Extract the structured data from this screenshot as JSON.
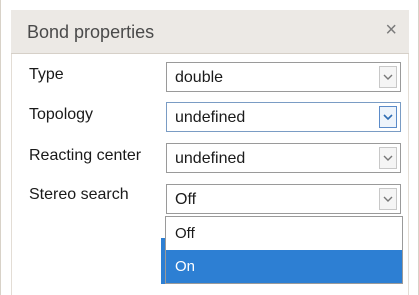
{
  "dialog": {
    "title": "Bond properties",
    "close_glyph": "×"
  },
  "fields": [
    {
      "label": "Type",
      "value": "double"
    },
    {
      "label": "Topology",
      "value": "undefined"
    },
    {
      "label": "Reacting center",
      "value": "undefined"
    },
    {
      "label": "Stereo search",
      "value": "Off"
    }
  ],
  "stereo_dropdown": {
    "options": [
      "Off",
      "On"
    ],
    "highlighted": "On"
  },
  "icons": {
    "close": "close-icon",
    "dropdown": "chevron-down-icon"
  },
  "colors": {
    "accent": "#2d7fd3",
    "titlebar": "#ece9e5"
  }
}
